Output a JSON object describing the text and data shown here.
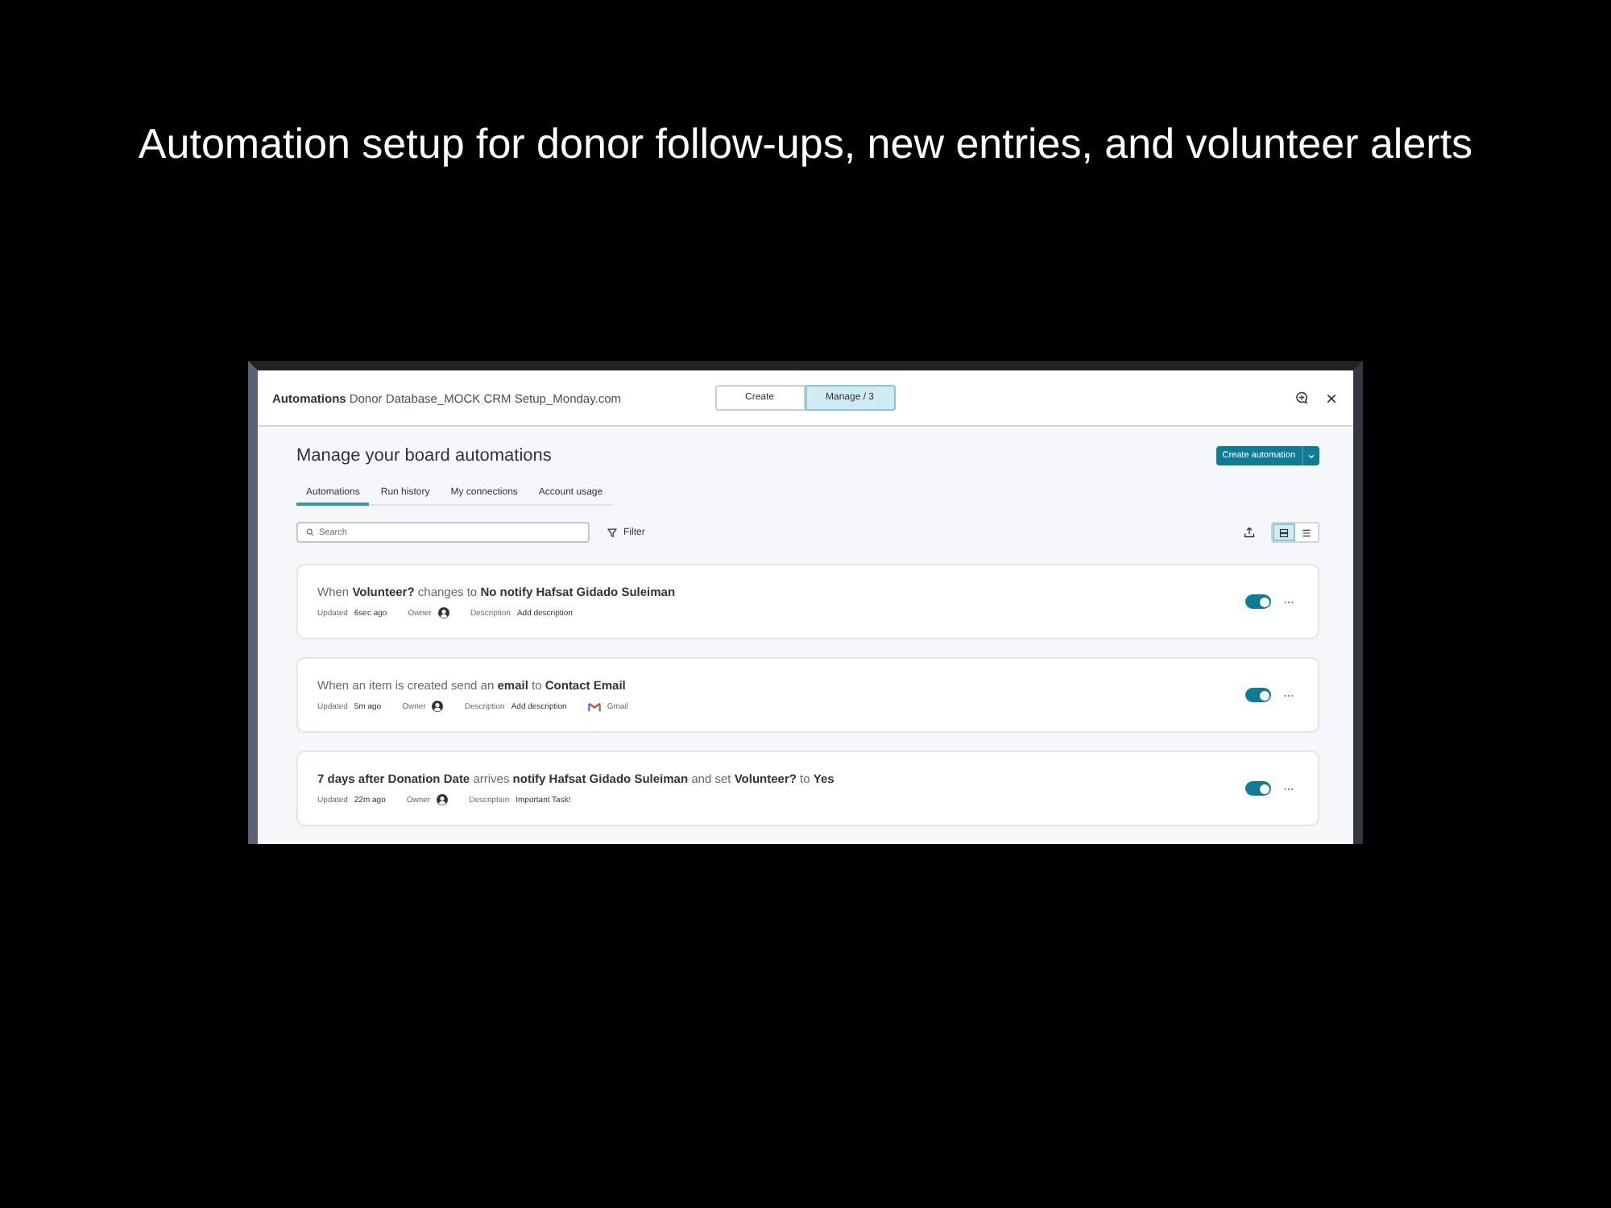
{
  "caption": "Automation setup for donor follow-ups, new entries, and volunteer alerts",
  "window": {
    "title": "Automations",
    "board_name": "Donor Database_MOCK CRM Setup_Monday.com"
  },
  "modes": [
    {
      "label": "Create",
      "selected": false
    },
    {
      "label": "Manage / 3",
      "selected": true
    }
  ],
  "heading": "Manage your board automations",
  "create_button": {
    "label": "Create automation"
  },
  "tabs": [
    {
      "label": "Automations",
      "selected": true
    },
    {
      "label": "Run history",
      "selected": false
    },
    {
      "label": "My connections",
      "selected": false
    },
    {
      "label": "Account usage",
      "selected": false
    }
  ],
  "search": {
    "placeholder": "Search"
  },
  "filter": {
    "label": "Filter"
  },
  "view_options": [
    {
      "kind": "cards",
      "selected": true
    },
    {
      "kind": "list",
      "selected": false
    }
  ],
  "automations": [
    {
      "recipe": "When **Volunteer?** changes to **No notify Hafsat Gidado Suleiman**",
      "updated_label": "Updated",
      "updated": "6sec ago",
      "owner_label": "Owner",
      "description_label": "Description",
      "description": "Add description",
      "on": true
    },
    {
      "recipe": "When an item is created send an **email** to **Contact Email**",
      "updated_label": "Updated",
      "updated": "5m ago",
      "owner_label": "Owner",
      "description_label": "Description",
      "description": "Add description",
      "integration": "Gmail",
      "on": true
    },
    {
      "recipe": "**7 days after Donation Date** arrives **notify Hafsat Gidado Suleiman** and set **Volunteer?** to **Yes**",
      "updated_label": "Updated",
      "updated": "22m ago",
      "owner_label": "Owner",
      "description_label": "Description",
      "description": "Important Task!",
      "on": true
    }
  ]
}
